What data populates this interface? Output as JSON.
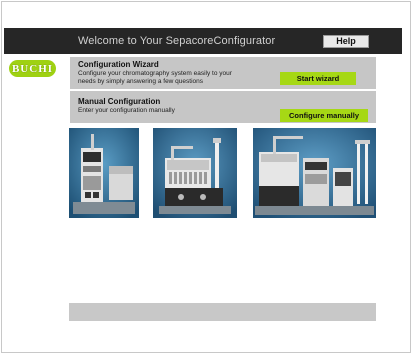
{
  "header": {
    "title": "Welcome to Your SepacoreConfigurator",
    "help_label": "Help"
  },
  "logo": {
    "text": "BUCHI"
  },
  "wizard": {
    "title": "Configuration Wizard",
    "desc_line1": "Configure your chromatography system easily to your",
    "desc_line2": "needs by simply answering a few questions",
    "button_label": "Start wizard"
  },
  "manual": {
    "title": "Manual Configuration",
    "desc_line1": "Enter your configuration manually",
    "button_label": "Configure manually"
  },
  "photos": [
    {
      "name": "sepacore-compact-system-photo"
    },
    {
      "name": "sepacore-fraction-collector-photo"
    },
    {
      "name": "sepacore-full-system-photo"
    }
  ],
  "colors": {
    "topbar": "#262626",
    "accent_green": "#a6d815",
    "panel_gray": "#c6c6c6",
    "photo_blue": "#2f6f9a"
  }
}
